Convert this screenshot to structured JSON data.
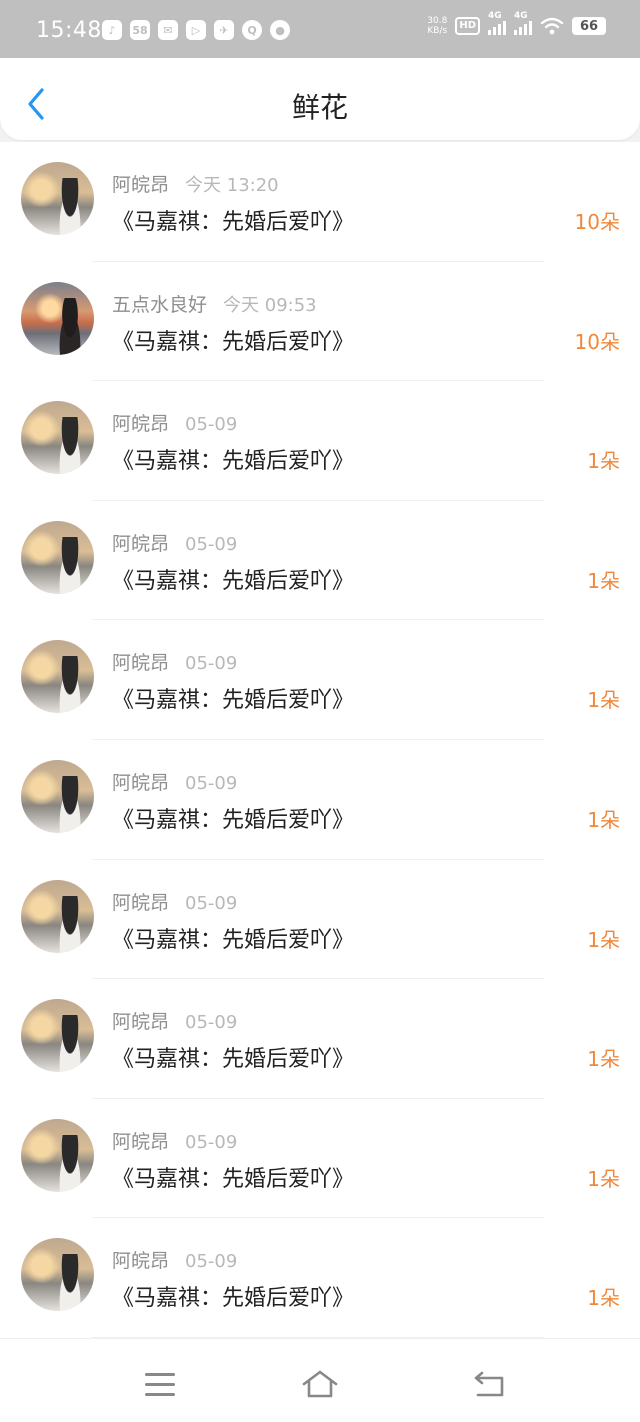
{
  "status_bar": {
    "time": "15:48",
    "notif_icons": [
      "♪",
      "58",
      "✉",
      "▷",
      "✈",
      "Q",
      "●"
    ],
    "net_speed_value": "30.8",
    "net_speed_unit": "KB/s",
    "hd_label": "HD",
    "sim1_label": "4G",
    "sim2_label": "4G",
    "battery": "66"
  },
  "header": {
    "back_icon": "chevron-left-icon",
    "title": "鲜花"
  },
  "entries": [
    {
      "user": "阿皖昂",
      "time": "今天 13:20",
      "title": "《马嘉祺：先婚后爱吖》",
      "flowers": "10朵",
      "avatar": "a"
    },
    {
      "user": "五点水良好",
      "time": "今天 09:53",
      "title": "《马嘉祺：先婚后爱吖》",
      "flowers": "10朵",
      "avatar": "b"
    },
    {
      "user": "阿皖昂",
      "time": "05-09",
      "title": "《马嘉祺：先婚后爱吖》",
      "flowers": "1朵",
      "avatar": "a"
    },
    {
      "user": "阿皖昂",
      "time": "05-09",
      "title": "《马嘉祺：先婚后爱吖》",
      "flowers": "1朵",
      "avatar": "a"
    },
    {
      "user": "阿皖昂",
      "time": "05-09",
      "title": "《马嘉祺：先婚后爱吖》",
      "flowers": "1朵",
      "avatar": "a"
    },
    {
      "user": "阿皖昂",
      "time": "05-09",
      "title": "《马嘉祺：先婚后爱吖》",
      "flowers": "1朵",
      "avatar": "a"
    },
    {
      "user": "阿皖昂",
      "time": "05-09",
      "title": "《马嘉祺：先婚后爱吖》",
      "flowers": "1朵",
      "avatar": "a"
    },
    {
      "user": "阿皖昂",
      "time": "05-09",
      "title": "《马嘉祺：先婚后爱吖》",
      "flowers": "1朵",
      "avatar": "a"
    },
    {
      "user": "阿皖昂",
      "time": "05-09",
      "title": "《马嘉祺：先婚后爱吖》",
      "flowers": "1朵",
      "avatar": "a"
    },
    {
      "user": "阿皖昂",
      "time": "05-09",
      "title": "《马嘉祺：先婚后爱吖》",
      "flowers": "1朵",
      "avatar": "a"
    }
  ],
  "bottom_nav": {
    "menu_icon": "menu-icon",
    "home_icon": "home-icon",
    "back_icon": "back-icon"
  },
  "colors": {
    "accent_blue": "#2196f3",
    "flower_orange": "#f0873a",
    "status_bar_bg": "#bfbfbf"
  }
}
